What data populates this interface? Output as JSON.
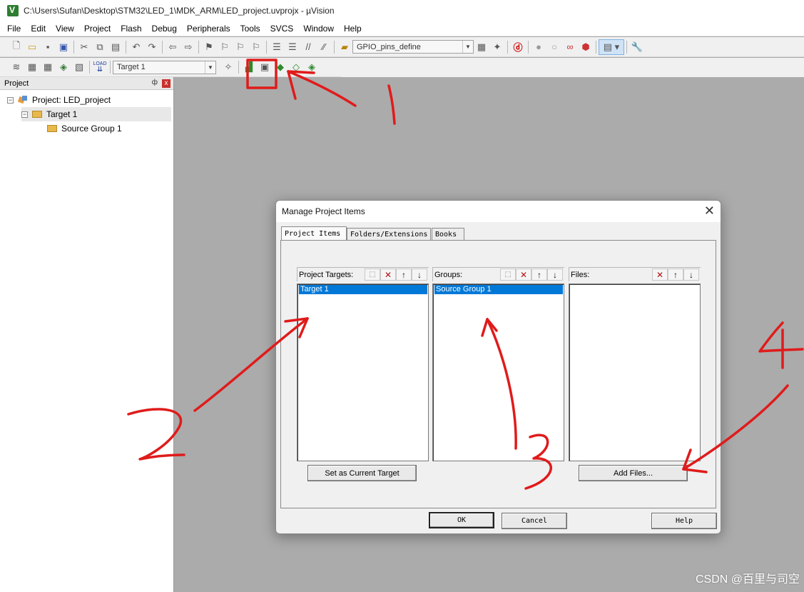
{
  "window": {
    "title": "C:\\Users\\Sufan\\Desktop\\STM32\\LED_1\\MDK_ARM\\LED_project.uvprojx - µVision"
  },
  "menu": [
    "File",
    "Edit",
    "View",
    "Project",
    "Flash",
    "Debug",
    "Peripherals",
    "Tools",
    "SVCS",
    "Window",
    "Help"
  ],
  "toolbar1": {
    "combo_value": "GPIO_pins_define"
  },
  "toolbar2": {
    "load_label": "LOAD",
    "target_combo": "Target 1"
  },
  "project_panel": {
    "title": "Project",
    "pin": "ф",
    "close": "x",
    "tree": {
      "root": "Project: LED_project",
      "target": "Target 1",
      "group": "Source Group 1"
    }
  },
  "dialog": {
    "title": "Manage Project Items",
    "close": "✕",
    "tabs": [
      "Project Items",
      "Folders/Extensions",
      "Books"
    ],
    "targets": {
      "label": "Project Targets:",
      "items": [
        "Target 1"
      ]
    },
    "groups": {
      "label": "Groups:",
      "items": [
        "Source Group 1"
      ]
    },
    "files": {
      "label": "Files:",
      "items": []
    },
    "buttons": {
      "set_current": "Set as Current Target",
      "add_files": "Add Files...",
      "ok": "OK",
      "cancel": "Cancel",
      "help": "Help"
    }
  },
  "watermark": "CSDN @百里与司空",
  "colors": {
    "annotation": "#e01b1b",
    "selection": "#0078d7",
    "workspace": "#ababab"
  }
}
